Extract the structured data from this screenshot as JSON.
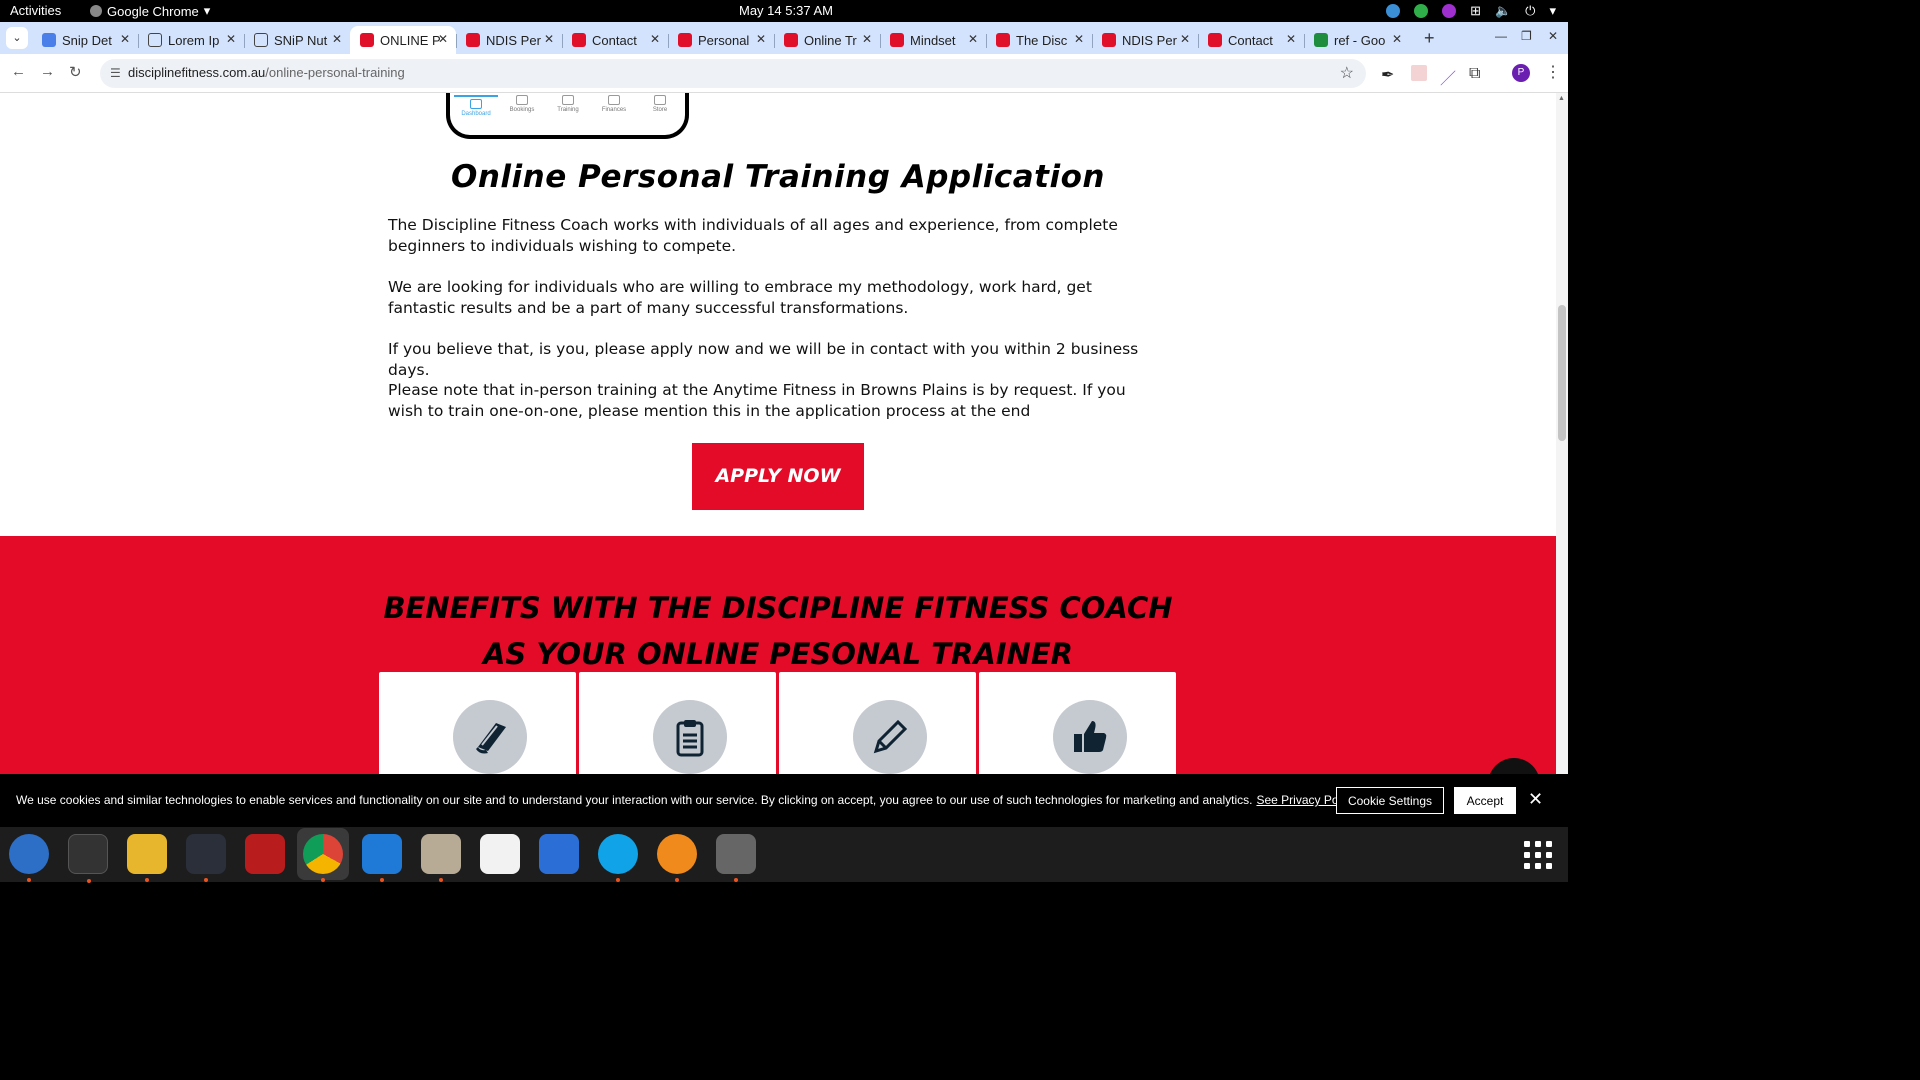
{
  "system": {
    "activities": "Activities",
    "app_name": "Google Chrome",
    "clock": "May 14  5:37 AM"
  },
  "tabs": [
    {
      "label": "Snip Det",
      "icon": "docs-icon"
    },
    {
      "label": "Lorem Ip",
      "icon": "lorem-icon"
    },
    {
      "label": "SNiP Nut",
      "icon": "snip-icon"
    },
    {
      "label": "ONLINE P",
      "icon": "discipline-fitness-icon",
      "active": true
    },
    {
      "label": "NDIS Per",
      "icon": "discipline-fitness-icon"
    },
    {
      "label": "Contact",
      "icon": "discipline-fitness-icon"
    },
    {
      "label": "Personal",
      "icon": "discipline-fitness-icon"
    },
    {
      "label": "Online Tr",
      "icon": "discipline-fitness-icon"
    },
    {
      "label": "Mindset",
      "icon": "discipline-fitness-icon"
    },
    {
      "label": "The Disc",
      "icon": "discipline-fitness-icon"
    },
    {
      "label": "NDIS Per",
      "icon": "discipline-fitness-icon"
    },
    {
      "label": "Contact",
      "icon": "discipline-fitness-icon"
    },
    {
      "label": "ref - Goo",
      "icon": "sheets-icon"
    }
  ],
  "address_bar": {
    "domain": "disciplinefitness.com.au",
    "path": "/online-personal-training"
  },
  "profile_initial": "P",
  "phone_nav": [
    "Dashboard",
    "Bookings",
    "Training",
    "Finances",
    "Store"
  ],
  "page": {
    "heading": "Online Personal Training Application",
    "paragraphs": [
      "The Discipline Fitness Coach works with individuals of all ages and experience, from complete beginners to individuals wishing to compete.",
      "We are looking for individuals who are willing to embrace my methodology, work hard, get fantastic results and be a part of many successful transformations.",
      "If you believe that, is you, please apply now and we will be in contact with you within 2 business days.",
      "Please note that in-person training at the Anytime Fitness in Browns Plains is by request. If you wish to train one-on-one, please mention this in the application process at the end"
    ],
    "apply_button": "APPLY NOW",
    "benefits_title_line1": "BENEFITS WITH THE DISCIPLINE FITNESS COACH",
    "benefits_title_line2": "AS YOUR ONLINE PESONAL TRAINER",
    "benefit_icons": [
      "book-icon",
      "clipboard-icon",
      "pencil-icon",
      "thumbs-up-icon"
    ]
  },
  "cookie_banner": {
    "message": "We use cookies and similar technologies to enable services and functionality on our site and to understand your interaction with our service. By clicking on accept, you agree to our use of such technologies for marketing and analytics.",
    "privacy_link": "See Privacy Policy",
    "settings_button": "Cookie Settings",
    "accept_button": "Accept"
  },
  "colors": {
    "brand_red": "#e30b27",
    "tabstrip": "#d3e3fd"
  }
}
